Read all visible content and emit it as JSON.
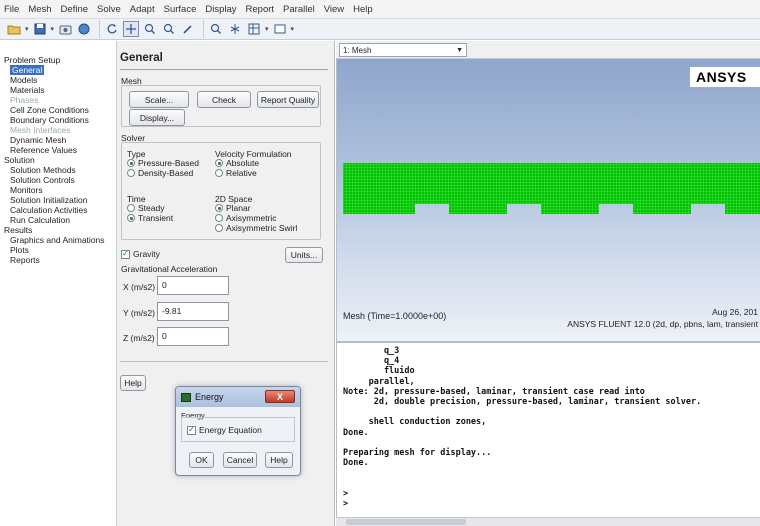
{
  "menu": [
    "File",
    "Mesh",
    "Define",
    "Solve",
    "Adapt",
    "Surface",
    "Display",
    "Report",
    "Parallel",
    "View",
    "Help"
  ],
  "tree": {
    "problem_setup": "Problem Setup",
    "general": "General",
    "models": "Models",
    "materials": "Materials",
    "phases": "Phases",
    "cell_zone": "Cell Zone Conditions",
    "boundary": "Boundary Conditions",
    "mesh_interfaces": "Mesh Interfaces",
    "dynamic_mesh": "Dynamic Mesh",
    "reference_values": "Reference Values",
    "solution": "Solution",
    "solution_methods": "Solution Methods",
    "solution_controls": "Solution Controls",
    "monitors": "Monitors",
    "solution_init": "Solution Initialization",
    "calc_activities": "Calculation Activities",
    "run_calc": "Run Calculation",
    "results": "Results",
    "graphics": "Graphics and Animations",
    "plots": "Plots",
    "reports": "Reports"
  },
  "general": {
    "title": "General",
    "mesh_label": "Mesh",
    "scale": "Scale...",
    "check": "Check",
    "report_quality": "Report Quality",
    "display": "Display...",
    "solver_label": "Solver",
    "type_label": "Type",
    "pressure_based": "Pressure-Based",
    "density_based": "Density-Based",
    "velocity_label": "Velocity Formulation",
    "absolute": "Absolute",
    "relative": "Relative",
    "time_label": "Time",
    "steady": "Steady",
    "transient": "Transient",
    "space_label": "2D Space",
    "planar": "Planar",
    "axisymmetric": "Axisymmetric",
    "axisymmetric_swirl": "Axisymmetric Swirl",
    "gravity": "Gravity",
    "units": "Units...",
    "grav_accel": "Gravitational Acceleration",
    "x_label": "X (m/s2)",
    "x_value": "0",
    "y_label": "Y (m/s2)",
    "y_value": "-9.81",
    "z_label": "Z (m/s2)",
    "z_value": "0",
    "help": "Help"
  },
  "energy_dialog": {
    "title": "Energy",
    "close": "X",
    "group": "Energy",
    "checkbox": "Energy Equation",
    "ok": "OK",
    "cancel": "Cancel",
    "help": "Help"
  },
  "graphics": {
    "tab": "1: Mesh",
    "logo": "ANSYS",
    "info": "Mesh  (Time=1.0000e+00)",
    "date": "Aug 26, 201",
    "subtitle": "ANSYS FLUENT 12.0 (2d, dp, pbns, lam, transient"
  },
  "console": {
    "lines": [
      "        q_3",
      "        q_4",
      "        fluido",
      "     parallel,",
      "Note: 2d, pressure-based, laminar, transient case read into",
      "      2d, double precision, pressure-based, laminar, transient solver.",
      "",
      "     shell conduction zones,",
      "Done.",
      "",
      "Preparing mesh for display...",
      "Done.",
      "",
      "",
      ">",
      ">"
    ]
  },
  "colors": {
    "mesh_green": "#00c400",
    "sky_top": "#8fa6cc",
    "tree_selected": "#3a6fc4"
  }
}
